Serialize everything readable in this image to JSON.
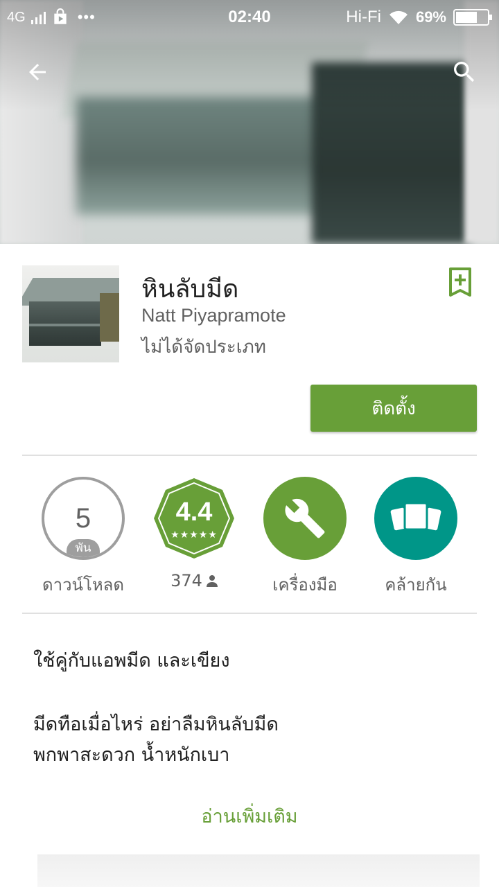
{
  "status_bar": {
    "network": "4G",
    "time": "02:40",
    "hifi": "Hi-Fi",
    "battery": "69%",
    "battery_level": 0.69
  },
  "app": {
    "title": "หินลับมีด",
    "developer": "Natt Piyapramote",
    "category": "ไม่ได้จัดประเภท",
    "install_label": "ติดตั้ง"
  },
  "stats": {
    "downloads": {
      "value": "5",
      "unit": "พัน",
      "label": "ดาวน์โหลด"
    },
    "rating": {
      "value": "4.4",
      "stars": 4.4,
      "count": "374"
    },
    "category": {
      "label": "เครื่องมือ",
      "icon": "wrench-icon"
    },
    "similar": {
      "label": "คล้ายกัน",
      "icon": "similar-cards-icon"
    }
  },
  "description": {
    "line1": "ใช้คู่กับแอพมีด และเขียง",
    "line2": "มีดทือเมื่อไหร่ อย่าลืมหินลับมีด",
    "line3": "พกพาสะดวก น้ำหนักเบา"
  },
  "read_more_label": "อ่านเพิ่มเติม",
  "colors": {
    "accent_green": "#689f38",
    "teal": "#009688",
    "gray": "#9e9e9e"
  }
}
